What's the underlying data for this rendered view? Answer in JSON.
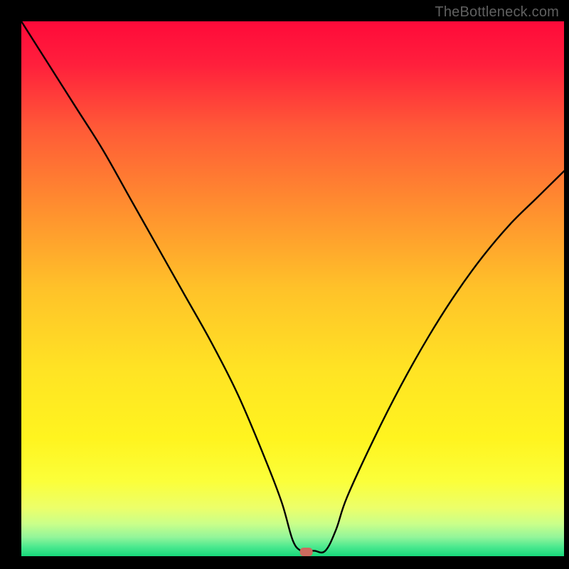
{
  "watermark": "TheBottleneck.com",
  "chart_data": {
    "type": "line",
    "title": "",
    "xlabel": "",
    "ylabel": "",
    "xlim": [
      0,
      100
    ],
    "ylim": [
      0,
      100
    ],
    "legend": false,
    "grid": false,
    "background": "rainbow-vertical-gradient (red → orange → yellow → green)",
    "series": [
      {
        "name": "curve",
        "stroke": "#000000",
        "x": [
          0,
          5,
          10,
          15,
          20,
          25,
          30,
          35,
          40,
          45,
          48,
          50,
          51.5,
          52.5,
          54,
          56,
          58,
          60,
          65,
          70,
          75,
          80,
          85,
          90,
          95,
          100
        ],
        "y": [
          100,
          92,
          84,
          76,
          67,
          58,
          49,
          40,
          30,
          18,
          10,
          3,
          1,
          1,
          1,
          1,
          5,
          11,
          22,
          32,
          41,
          49,
          56,
          62,
          67,
          72
        ]
      }
    ],
    "annotations": [
      {
        "type": "marker",
        "shape": "rounded-rect",
        "x": 52.5,
        "y": 0.8,
        "fill": "#cc6a5e"
      }
    ]
  }
}
